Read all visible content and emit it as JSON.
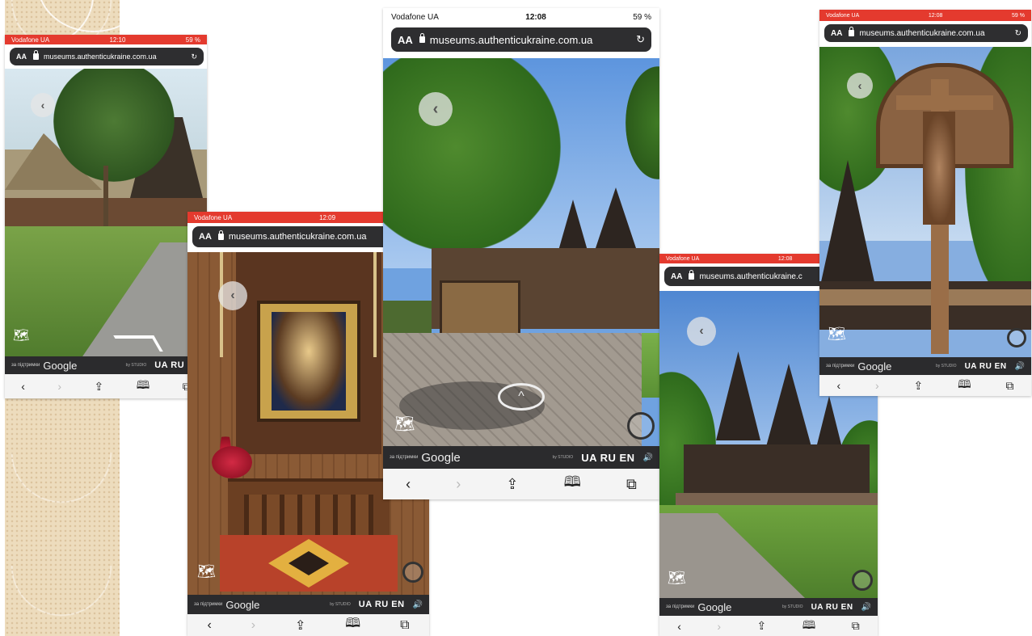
{
  "phones": [
    {
      "id": "phone-1",
      "status": {
        "carrier": "Vodafone UA",
        "time": "12:10",
        "battery": "59 %"
      },
      "url": "museums.authenticukraine.com.ua",
      "aa": "AA",
      "google": {
        "by": "за підтримки",
        "brand": "Google",
        "studio": "by STUDIO",
        "langs": "UA RU EN"
      }
    },
    {
      "id": "phone-2",
      "status": {
        "carrier": "Vodafone UA",
        "time": "12:09",
        "battery": ""
      },
      "url": "museums.authenticukraine.com.ua",
      "aa": "AA",
      "google": {
        "by": "за підтримки",
        "brand": "Google",
        "studio": "by STUDIO",
        "langs": "UA RU EN"
      }
    },
    {
      "id": "phone-3",
      "status": {
        "carrier": "Vodafone UA",
        "time": "12:08",
        "battery": "59 %"
      },
      "url": "museums.authenticukraine.com.ua",
      "aa": "AA",
      "google": {
        "by": "за підтримки",
        "brand": "Google",
        "studio": "by STUDIO",
        "langs": "UA RU EN"
      }
    },
    {
      "id": "phone-4",
      "status": {
        "carrier": "Vodafone UA",
        "time": "12:08",
        "battery": ""
      },
      "url": "museums.authenticukraine.c",
      "aa": "AA",
      "google": {
        "by": "за підтримки",
        "brand": "Google",
        "studio": "by STUDIO",
        "langs": "UA RU EN"
      }
    },
    {
      "id": "phone-5",
      "status": {
        "carrier": "Vodafone UA",
        "time": "12:08",
        "battery": "59 %"
      },
      "url": "museums.authenticukraine.com.ua",
      "aa": "AA",
      "google": {
        "by": "за підтримки",
        "brand": "Google",
        "studio": "by STUDIO",
        "langs": "UA RU EN"
      }
    }
  ],
  "icons": {
    "back": "‹",
    "forward": "›",
    "share": "⇪",
    "bookmarks": "🕮",
    "tabs": "⧉",
    "reload": "↻",
    "scene_back": "‹",
    "speaker": "🔊",
    "map": "🗺"
  },
  "colors": {
    "status_red": "#e43a2e",
    "url_bar": "#2e2e30",
    "google_bar": "#2b2b2d",
    "toolbar": "#f4f4f4"
  }
}
